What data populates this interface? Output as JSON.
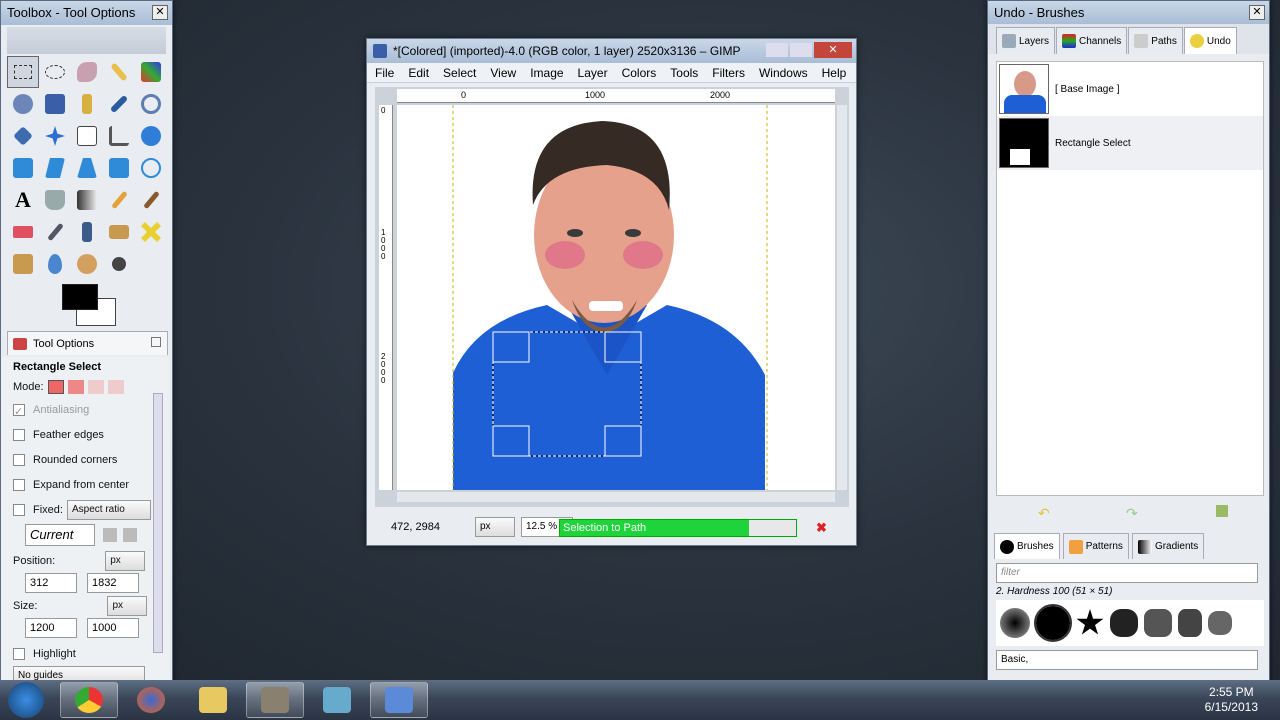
{
  "toolbox": {
    "title": "Toolbox - Tool Options",
    "close": "✕",
    "options_tab": "Tool Options",
    "tool_name": "Rectangle Select",
    "mode_label": "Mode:",
    "antialiasing": "Antialiasing",
    "feather": "Feather edges",
    "rounded": "Rounded corners",
    "expand": "Expand from center",
    "fixed": "Fixed:",
    "fixed_value": "Aspect ratio",
    "current": "Current",
    "position_label": "Position:",
    "position_unit": "px",
    "pos_x": "312",
    "pos_y": "1832",
    "size_label": "Size:",
    "size_unit": "px",
    "size_w": "1200",
    "size_h": "1000",
    "highlight": "Highlight",
    "guides": "No guides"
  },
  "gimp": {
    "title": "*[Colored] (imported)-4.0 (RGB color, 1 layer) 2520x3136 – GIMP",
    "menus": [
      "File",
      "Edit",
      "Select",
      "View",
      "Image",
      "Layer",
      "Colors",
      "Tools",
      "Filters",
      "Windows",
      "Help"
    ],
    "ruler_ticks": [
      "0",
      "1000",
      "2000"
    ],
    "vruler_ticks": [
      "0",
      "1000",
      "2000"
    ],
    "coords": "472, 2984",
    "unit": "px",
    "zoom": "12.5 %",
    "progress_text": "Selection to Path",
    "progress_fraction": 0.8
  },
  "right": {
    "title": "Undo - Brushes",
    "tabs": [
      "Layers",
      "Channels",
      "Paths",
      "Undo"
    ],
    "undo_items": [
      "[ Base Image ]",
      "Rectangle Select"
    ],
    "brush_tabs": [
      "Brushes",
      "Patterns",
      "Gradients"
    ],
    "filter_placeholder": "filter",
    "brush_name": "2. Hardness 100 (51 × 51)",
    "brush_tag": "Basic,"
  },
  "taskbar": {
    "time": "2:55 PM",
    "date": "6/15/2013"
  }
}
